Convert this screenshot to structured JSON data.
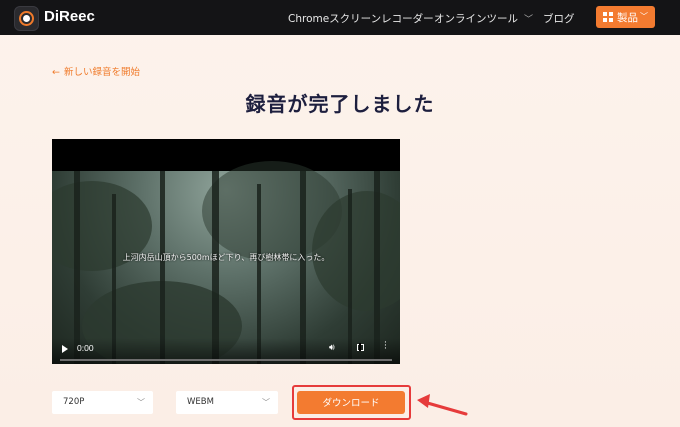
{
  "header": {
    "brand": "DiReec",
    "nav": [
      {
        "label": "Chromeスクリーンレコーダー"
      },
      {
        "label": "オンラインツール",
        "chevron": "chevron-down-icon"
      },
      {
        "label": "ブログ"
      }
    ],
    "products_button": {
      "label": "製品",
      "icon": "grid-icon"
    }
  },
  "back_link": "新しい録音を開始",
  "page_title": "録音が完了しました",
  "video": {
    "subtitle": "上河内岳山頂から500mほど下り、再び樹林帯に入った。",
    "time": "0:00",
    "progress": 0
  },
  "options": {
    "resolution": "720P",
    "format": "WEBM"
  },
  "download_label": "ダウンロード",
  "colors": {
    "accent": "#f37b30",
    "title": "#1d1f3e",
    "highlight": "#e63b3b"
  }
}
